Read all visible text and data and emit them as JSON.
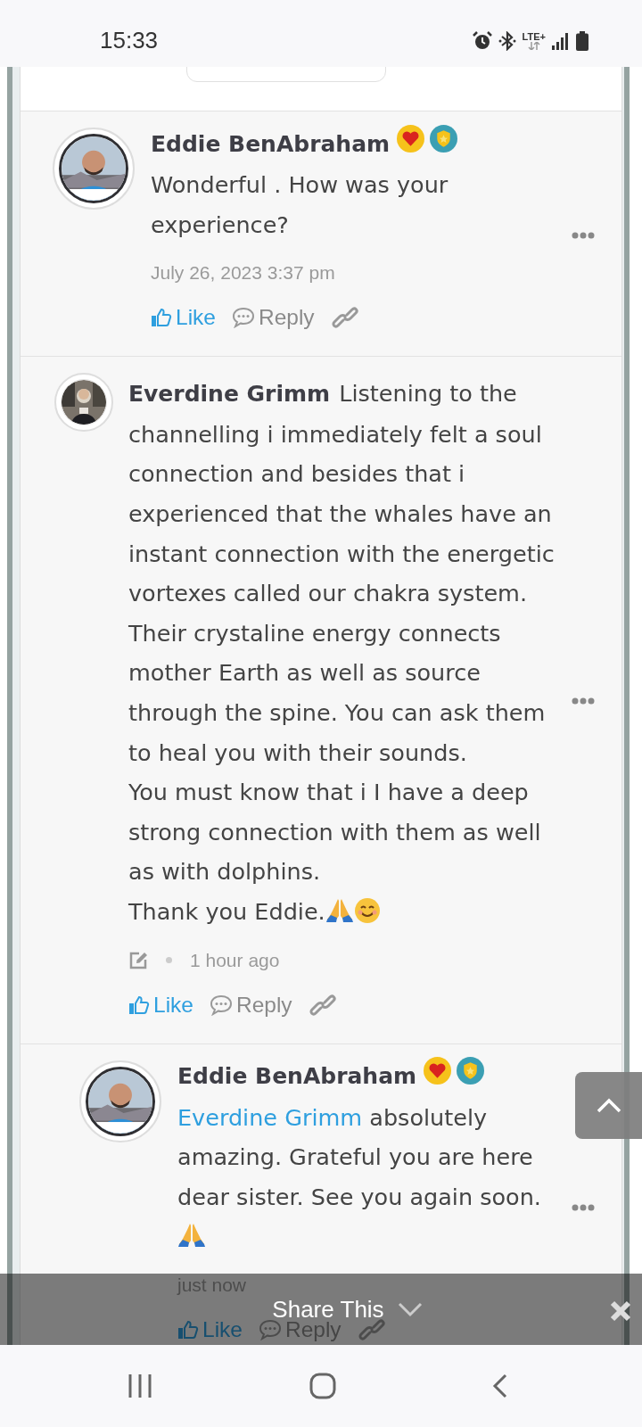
{
  "status_bar": {
    "time": "15:33",
    "network": "LTE+"
  },
  "comments": [
    {
      "kind": "reply",
      "author": "Eddie BenAbraham",
      "name_inline": false,
      "badges": [
        {
          "kind": "heart"
        },
        {
          "kind": "shield"
        }
      ],
      "body": "Wonderful . How was your experience?",
      "timestamp": "July 26, 2023 3:37 pm",
      "edit_icon": false,
      "like": "Like",
      "reply": "Reply"
    },
    {
      "kind": "comment",
      "author": "Everdine Grimm",
      "name_inline": true,
      "body": "Listening to the channelling i immediately felt a soul connection and besides that i experienced that the whales have an instant connection with the energetic vortexes called our chakra system. Their crystaline energy connects mother Earth as well as source through the spine. You can ask them to heal you with their sounds.\nYou must know that i I have a deep strong connection with them as well as with dolphins.\nThank you Eddie.",
      "emoji": [
        {
          "kind": "pray"
        },
        {
          "kind": "smile"
        }
      ],
      "timestamp": "1 hour ago",
      "edit_icon": true,
      "like": "Like",
      "reply": "Reply",
      "children": [
        {
          "kind": "reply",
          "author": "Eddie BenAbraham",
          "name_inline": false,
          "badges": [
            {
              "kind": "heart"
            },
            {
              "kind": "shield"
            }
          ],
          "mention": "Everdine Grimm",
          "body": "absolutely amazing. Grateful you are here dear sister. See you again soon.",
          "emoji": [
            {
              "kind": "pray"
            }
          ],
          "timestamp": "just now",
          "edit_icon": false,
          "like": "Like",
          "reply": "Reply"
        }
      ]
    }
  ],
  "share_bar": {
    "label": "Share This"
  }
}
